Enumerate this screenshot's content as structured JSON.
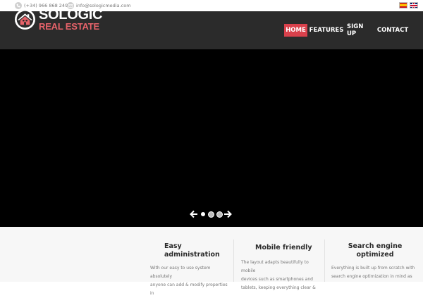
{
  "topbar": {
    "phone": "(+34) 966 868 249",
    "email": "info@sologicmedia.com",
    "languages": [
      {
        "code": "es",
        "icon": "spain-flag-icon"
      },
      {
        "code": "en",
        "icon": "uk-flag-icon"
      }
    ]
  },
  "logo": {
    "name": "SOLOGIC",
    "sub": "REAL ESTATE",
    "accent_color": "#e7636a"
  },
  "nav": {
    "items": [
      {
        "label": "HOME",
        "active": true
      },
      {
        "label": "FEATURES",
        "active": false
      },
      {
        "label": "SIGN UP",
        "active": false
      },
      {
        "label": "CONTACT",
        "active": false
      }
    ],
    "active_color": "#d9414c"
  },
  "slider": {
    "background": "#000000",
    "slide_count": 3,
    "active_slide": 1
  },
  "features": [
    {
      "title_line1": "Easy",
      "title_line2": "administration",
      "text_line1": "With our easy to use system absolutely",
      "text_line2": "anyone can add & modify properties in"
    },
    {
      "title_line1": "Mobile friendly",
      "title_line2": "",
      "text_line1": "The layout adapts beautifully to mobile",
      "text_line2": "devices such as smartphones and",
      "text_line3": "tablets, keeping everything clear &"
    },
    {
      "title_line1": "Search engine",
      "title_line2": "optimized",
      "text_line1": "Everything is built up from scratch with",
      "text_line2": "search engine optimization in mind as"
    }
  ]
}
